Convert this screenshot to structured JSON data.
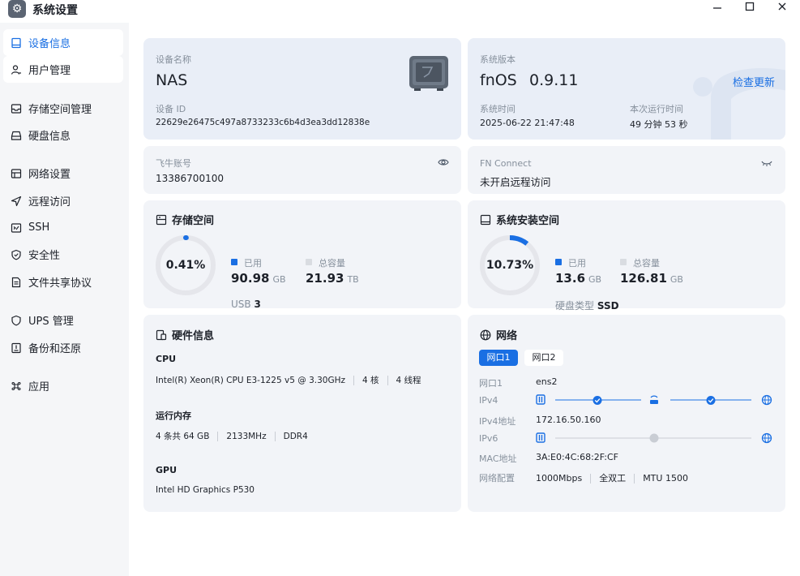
{
  "window": {
    "title": "系统设置",
    "icon": "gear-icon",
    "controls": [
      "minimize-icon",
      "maximize-icon",
      "close-icon"
    ]
  },
  "sidebar": {
    "items": [
      {
        "label": "设备信息",
        "icon": "monitor-icon",
        "active": true
      },
      {
        "label": "用户管理",
        "icon": "user-icon"
      },
      {
        "label": "存储空间管理",
        "icon": "storage-icon"
      },
      {
        "label": "硬盘信息",
        "icon": "disk-icon"
      },
      {
        "label": "网络设置",
        "icon": "network-icon"
      },
      {
        "label": "远程访问",
        "icon": "send-icon"
      },
      {
        "label": "SSH",
        "icon": "terminal-icon"
      },
      {
        "label": "安全性",
        "icon": "shield-icon"
      },
      {
        "label": "文件共享协议",
        "icon": "document-icon"
      },
      {
        "label": "UPS 管理",
        "icon": "ups-shield-icon"
      },
      {
        "label": "备份和还原",
        "icon": "backup-icon"
      },
      {
        "label": "应用",
        "icon": "command-icon"
      }
    ]
  },
  "device": {
    "name_label": "设备名称",
    "name": "NAS",
    "id_label": "设备 ID",
    "id": "22629e26475c497a8733233c6b4d3ea3dd12838e"
  },
  "system": {
    "version_label": "系统版本",
    "os": "fnOS",
    "version": "0.9.11",
    "check_update": "检查更新",
    "time_label": "系统时间",
    "time": "2025-06-22 21:47:48",
    "uptime_label": "本次运行时间",
    "uptime": "49 分钟 53 秒"
  },
  "account": {
    "label": "飞牛账号",
    "value": "13386700100"
  },
  "fn_connect": {
    "label": "FN Connect",
    "value": "未开启远程访问"
  },
  "storage": {
    "title": "存储空间",
    "percent_text": "0.41%",
    "percent": 0.41,
    "used_label": "已用",
    "used_value": "90.98",
    "used_unit": "GB",
    "total_label": "总容量",
    "total_value": "21.93",
    "total_unit": "TB",
    "usb_label": "USB",
    "usb_value": "3"
  },
  "sys_install": {
    "title": "系统安装空间",
    "percent_text": "10.73%",
    "percent": 10.73,
    "used_label": "已用",
    "used_value": "13.6",
    "used_unit": "GB",
    "total_label": "总容量",
    "total_value": "126.81",
    "total_unit": "GB",
    "disk_type_label": "硬盘类型",
    "disk_type": "SSD"
  },
  "hardware": {
    "title": "硬件信息",
    "cpu_label": "CPU",
    "cpu_model": "Intel(R) Xeon(R) CPU E3-1225 v5 @ 3.30GHz",
    "cpu_cores": "4 核",
    "cpu_threads": "4 线程",
    "mem_label": "运行内存",
    "mem_size": "4 条共 64 GB",
    "mem_speed": "2133MHz",
    "mem_type": "DDR4",
    "gpu_label": "GPU",
    "gpu_model": "Intel HD Graphics P530"
  },
  "network": {
    "title": "网络",
    "tabs": [
      "网口1",
      "网口2"
    ],
    "port_label": "网口1",
    "port_value": "ens2",
    "ipv4_label": "IPv4",
    "ipv4_addr_label": "IPv4地址",
    "ipv4_addr": "172.16.50.160",
    "ipv6_label": "IPv6",
    "mac_label": "MAC地址",
    "mac": "3A:E0:4C:68:2F:CF",
    "config_label": "网络配置",
    "speed": "1000Mbps",
    "duplex": "全双工",
    "mtu": "MTU 1500"
  },
  "colors": {
    "accent": "#1a6fe3",
    "ring_track": "#e5e6eb",
    "card_bg": "#f2f4f8",
    "card_blue_bg": "#e9eef7"
  }
}
